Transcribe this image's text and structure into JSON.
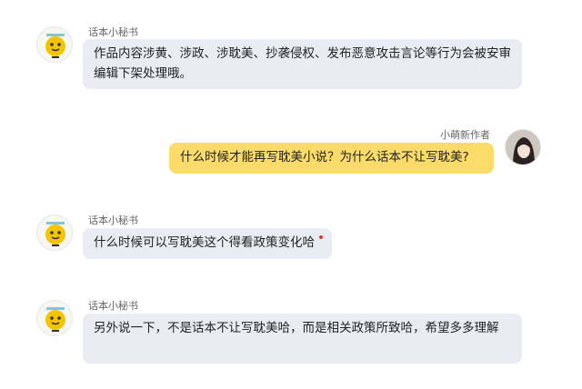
{
  "messages": [
    {
      "sender": "话本小秘书",
      "side": "left",
      "text": "作品内容涉黄、涉政、涉耽美、抄袭侵权、发布恶意攻击言论等行为会被安审编辑下架处理哦。",
      "avatar_icon": "emoji-mascot-icon"
    },
    {
      "sender": "小萌新作者",
      "side": "right",
      "text": "什么时候才能再写耽美小说？为什么话本不让写耽美?",
      "avatar_icon": "user-portrait-icon"
    },
    {
      "sender": "话本小秘书",
      "side": "left",
      "text": "什么时候可以写耽美这个得看政策变化哈",
      "avatar_icon": "emoji-mascot-icon",
      "unread_dot_color": "#e6332a"
    },
    {
      "sender": "话本小秘书",
      "side": "left",
      "text": "另外说一下，不是话本不让写耽美哈，而是相关政策所致哈，希望多多理解",
      "avatar_icon": "emoji-mascot-icon"
    }
  ],
  "colors": {
    "bot_bubble": "#e9edf3",
    "user_bubble": "#fbdc6a"
  }
}
